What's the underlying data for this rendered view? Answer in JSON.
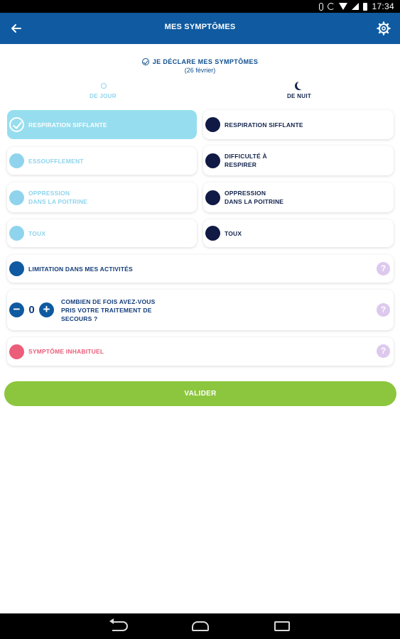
{
  "status_bar": {
    "time": "17:34"
  },
  "app_bar": {
    "title": "MES SYMPTÔMES"
  },
  "declare": {
    "title": "JE DÉCLARE MES SYMPTÔMES",
    "date": "(26 février)"
  },
  "tabs": {
    "day": "DE JOUR",
    "night": "DE NUIT"
  },
  "day_symptoms": [
    {
      "line1": "RESPIRATION SIFFLANTE",
      "line2": "",
      "selected": true
    },
    {
      "line1": "ESSOUFFLEMENT",
      "line2": "",
      "selected": false
    },
    {
      "line1": "OPPRESSION",
      "line2": "DANS LA POITRINE",
      "selected": false
    },
    {
      "line1": "TOUX",
      "line2": "",
      "selected": false
    }
  ],
  "night_symptoms": [
    {
      "line1": "RESPIRATION SIFFLANTE",
      "line2": ""
    },
    {
      "line1": "DIFFICULTÉ À",
      "line2": "RESPIRER"
    },
    {
      "line1": "OPPRESSION",
      "line2": "DANS LA POITRINE"
    },
    {
      "line1": "TOUX",
      "line2": ""
    }
  ],
  "activity_limitation": {
    "label": "LIMITATION DANS MES ACTIVITÉS",
    "help": "?"
  },
  "rescue_treatment": {
    "count": "0",
    "minus": "−",
    "plus": "+",
    "question_line1": "COMBIEN DE FOIS AVEZ-VOUS",
    "question_line2": "PRIS VOTRE TRAITEMENT DE",
    "question_line3": "SECOURS ?",
    "help": "?"
  },
  "unusual_symptom": {
    "label": "SYMPTÔME INHABITUEL",
    "help": "?"
  },
  "validate_button": "VALIDER",
  "colors": {
    "primary": "#0f5aa0",
    "day": "#8fd4ec",
    "night": "#101a45",
    "unusual": "#ec5d7a",
    "validate": "#8cc63e",
    "help": "#ddc9ee"
  }
}
